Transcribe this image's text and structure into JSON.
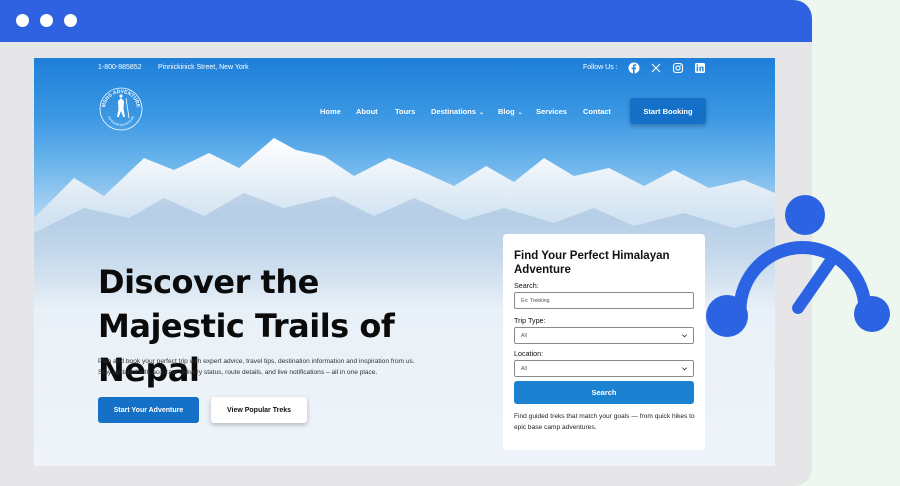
{
  "window": {
    "controls": [
      "dot",
      "dot",
      "dot"
    ]
  },
  "topbar": {
    "phone": "1-800-985852",
    "address": "Pinnickinick Street, New York",
    "follow_label": "Follow Us :",
    "social_icons": [
      "facebook-icon",
      "x-icon",
      "instagram-icon",
      "linkedin-icon"
    ]
  },
  "logo": {
    "top_text": "MSNS ADVENTURE",
    "bottom_text": "OUTDOOR ADVENTURE"
  },
  "nav": {
    "items": [
      {
        "label": "Home"
      },
      {
        "label": "About"
      },
      {
        "label": "Tours"
      },
      {
        "label": "Destinations"
      },
      {
        "label": "Blog"
      },
      {
        "label": "Services"
      },
      {
        "label": "Contact"
      }
    ],
    "cta": "Start Booking"
  },
  "hero": {
    "title": "Discover the Majestic Trails of Nepal",
    "description_line1": "Plan and book your perfect trip with expert advice, travel tips, destination information and inspiration from us.",
    "description_line2": "Stay updated with accurate delivery status, route details, and live notifications – all in one place.",
    "primary_button": "Start Your Adventure",
    "secondary_button": "View Popular Treks"
  },
  "search_card": {
    "title": "Find Your Perfect Himalayan Adventure",
    "search_label": "Search:",
    "search_placeholder": "Ex: Trekking",
    "trip_type_label": "Trip Type:",
    "trip_type_value": "All",
    "location_label": "Location:",
    "location_value": "All",
    "search_button": "Search",
    "note": "Find guided treks that match your goals — from quick hikes to epic base camp adventures."
  },
  "colors": {
    "titlebar": "#2f62e0",
    "primary": "#1570c8",
    "search_button": "#1b82d2",
    "decoration": "#2b63e3",
    "page_background": "#eef7ef"
  }
}
